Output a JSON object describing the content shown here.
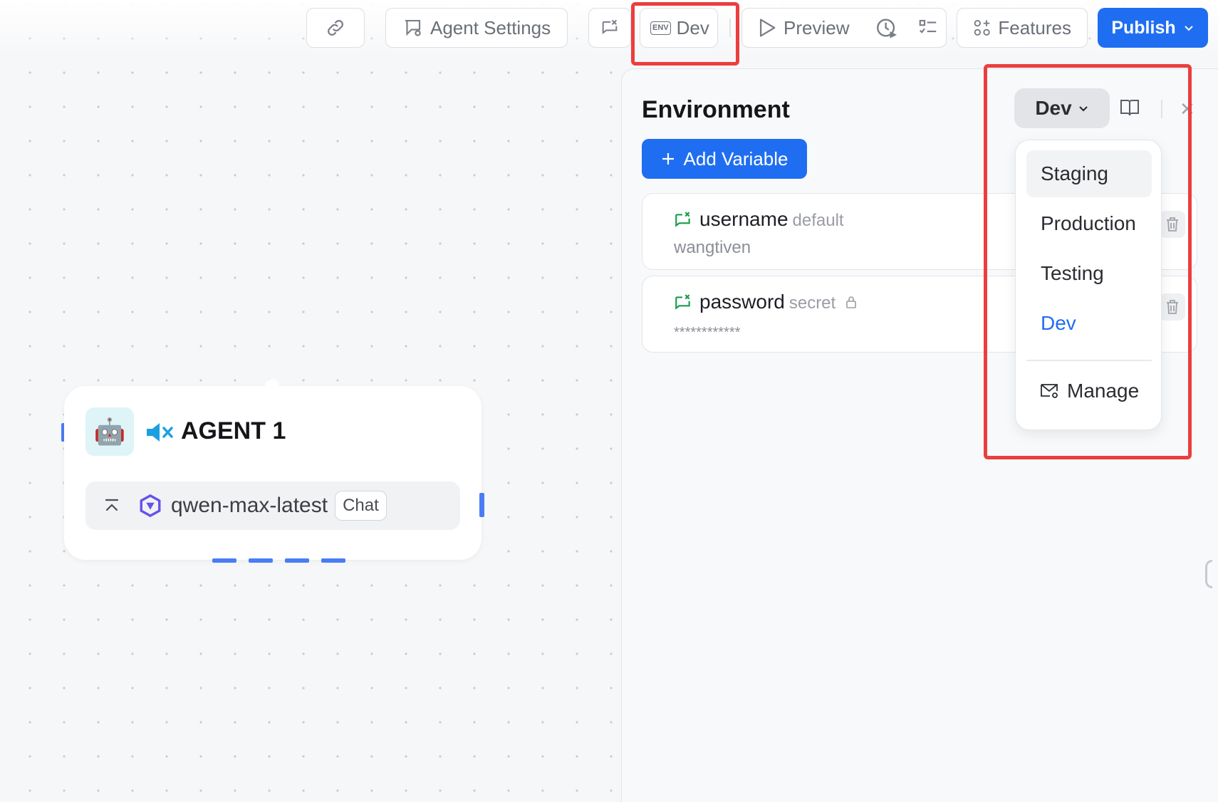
{
  "toolbar": {
    "agent_settings_label": "Agent Settings",
    "env_badge": "ENV",
    "env_label": "Dev",
    "preview_label": "Preview",
    "features_label": "Features",
    "publish_label": "Publish"
  },
  "agent_node": {
    "title": "AGENT 1",
    "avatar": "🤖",
    "model_name": "qwen-max-latest",
    "model_mode": "Chat"
  },
  "environment_panel": {
    "title": "Environment",
    "add_variable_label": "Add Variable",
    "selected_env": "Dev",
    "variables": [
      {
        "name": "username",
        "type": "default",
        "value": "wangtiven",
        "icon": "variable-icon"
      },
      {
        "name": "password",
        "type": "secret",
        "value": "************",
        "icon": "variable-icon",
        "locked": true
      }
    ],
    "dropdown": {
      "options": [
        "Staging",
        "Production",
        "Testing",
        "Dev"
      ],
      "hovered": "Staging",
      "active": "Dev",
      "manage_label": "Manage"
    }
  },
  "colors": {
    "accent": "#1f6ef2",
    "highlight": "#ec3e3e",
    "variable_icon": "#1a9c4a"
  }
}
